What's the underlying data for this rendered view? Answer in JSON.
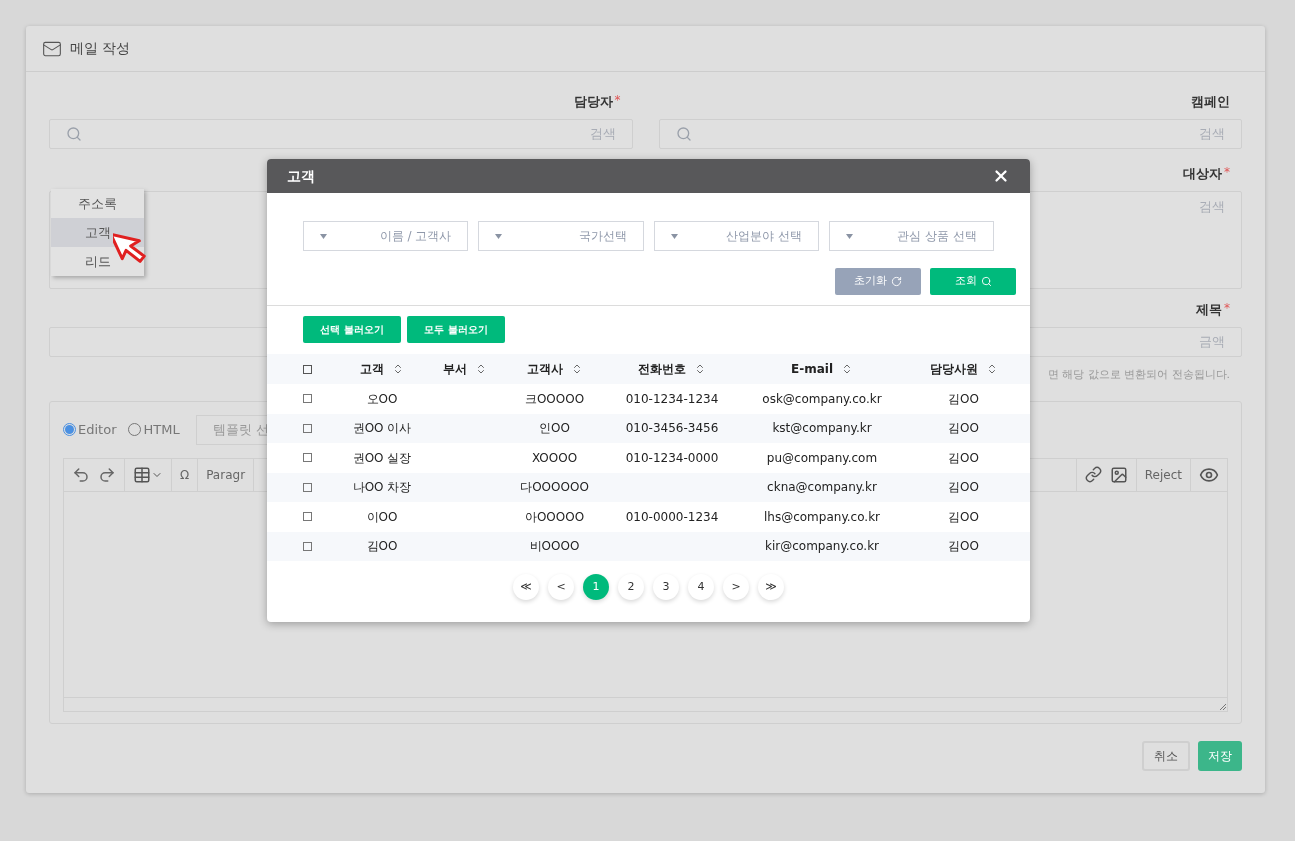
{
  "page": {
    "title": "메일 작성"
  },
  "owner_field": {
    "label": "담당자",
    "mark": "*",
    "placeholder": "검색"
  },
  "campaign_field": {
    "label": "캠페인",
    "placeholder": "검색"
  },
  "recipient_field": {
    "label": "대상자",
    "mark": "*",
    "placeholder": "검색"
  },
  "source_menu": [
    {
      "label": "주소록",
      "selected": false
    },
    {
      "label": "고객",
      "selected": true
    },
    {
      "label": "리드",
      "selected": false
    }
  ],
  "subject_field": {
    "label": "제목",
    "mark": "*",
    "placeholder": "금액"
  },
  "hint": "면 해당 값으로 변환되어 전송됩니다.",
  "editor": {
    "modes": [
      {
        "label": "Editor",
        "selected": true
      },
      {
        "label": "HTML",
        "selected": false
      }
    ],
    "template_select": "템플릿 선",
    "toolbar_left": [
      [
        {
          "kind": "undo"
        },
        {
          "kind": "redo"
        }
      ],
      [
        {
          "kind": "table"
        }
      ],
      [
        {
          "kind": "text",
          "label": "Ω"
        }
      ],
      [
        {
          "kind": "text",
          "label": "Paragr"
        }
      ]
    ],
    "toolbar_right": [
      [
        {
          "kind": "link"
        },
        {
          "kind": "image"
        }
      ],
      [
        {
          "kind": "text",
          "label": "Reject"
        }
      ],
      [
        {
          "kind": "eye"
        }
      ]
    ]
  },
  "footer_buttons": [
    {
      "label": "취소",
      "kind": "secondary"
    },
    {
      "label": "저장",
      "kind": "primary"
    }
  ],
  "modal": {
    "title": "고객",
    "filters": [
      {
        "placeholder": "이름 / 고객사"
      },
      {
        "placeholder": "국가선택"
      },
      {
        "placeholder": "산업분야 선택"
      },
      {
        "placeholder": "관심 상품 선택"
      }
    ],
    "actions": [
      {
        "label": "초기화",
        "kind": "reset"
      },
      {
        "label": "조회",
        "kind": "search"
      }
    ],
    "load_buttons": [
      "선택 불러오기",
      "모두 불러오기"
    ],
    "table": {
      "header_checked": false,
      "columns": [
        "고객",
        "부서",
        "고객사",
        "전화번호",
        "E-mail",
        "담당사원"
      ],
      "rows": [
        {
          "checked": false,
          "cells": [
            "오OO",
            "",
            "크OOOOO",
            "010-1234-1234",
            "osk@company.co.kr",
            "김OO"
          ]
        },
        {
          "checked": false,
          "cells": [
            "권OO 이사",
            "",
            "인OO",
            "010-3456-3456",
            "kst@company.kr",
            "김OO"
          ]
        },
        {
          "checked": false,
          "cells": [
            "권OO 실장",
            "",
            "XOOOO",
            "010-1234-0000",
            "pu@company.com",
            "김OO"
          ]
        },
        {
          "checked": false,
          "cells": [
            "나OO 차장",
            "",
            "다OOOOOO",
            "",
            "ckna@company.kr",
            "김OO"
          ]
        },
        {
          "checked": false,
          "cells": [
            "이OO",
            "",
            "아OOOOO",
            "010-0000-1234",
            "lhs@company.co.kr",
            "김OO"
          ]
        },
        {
          "checked": false,
          "cells": [
            "김OO",
            "",
            "비OOOO",
            "",
            "kir@company.co.kr",
            "김OO"
          ]
        }
      ]
    },
    "pagination": [
      {
        "label": "≪",
        "selected": false
      },
      {
        "label": "<",
        "selected": false
      },
      {
        "label": "1",
        "selected": true
      },
      {
        "label": "2",
        "selected": false
      },
      {
        "label": "3",
        "selected": false
      },
      {
        "label": "4",
        "selected": false
      },
      {
        "label": ">",
        "selected": false
      },
      {
        "label": "≫",
        "selected": false
      }
    ]
  }
}
